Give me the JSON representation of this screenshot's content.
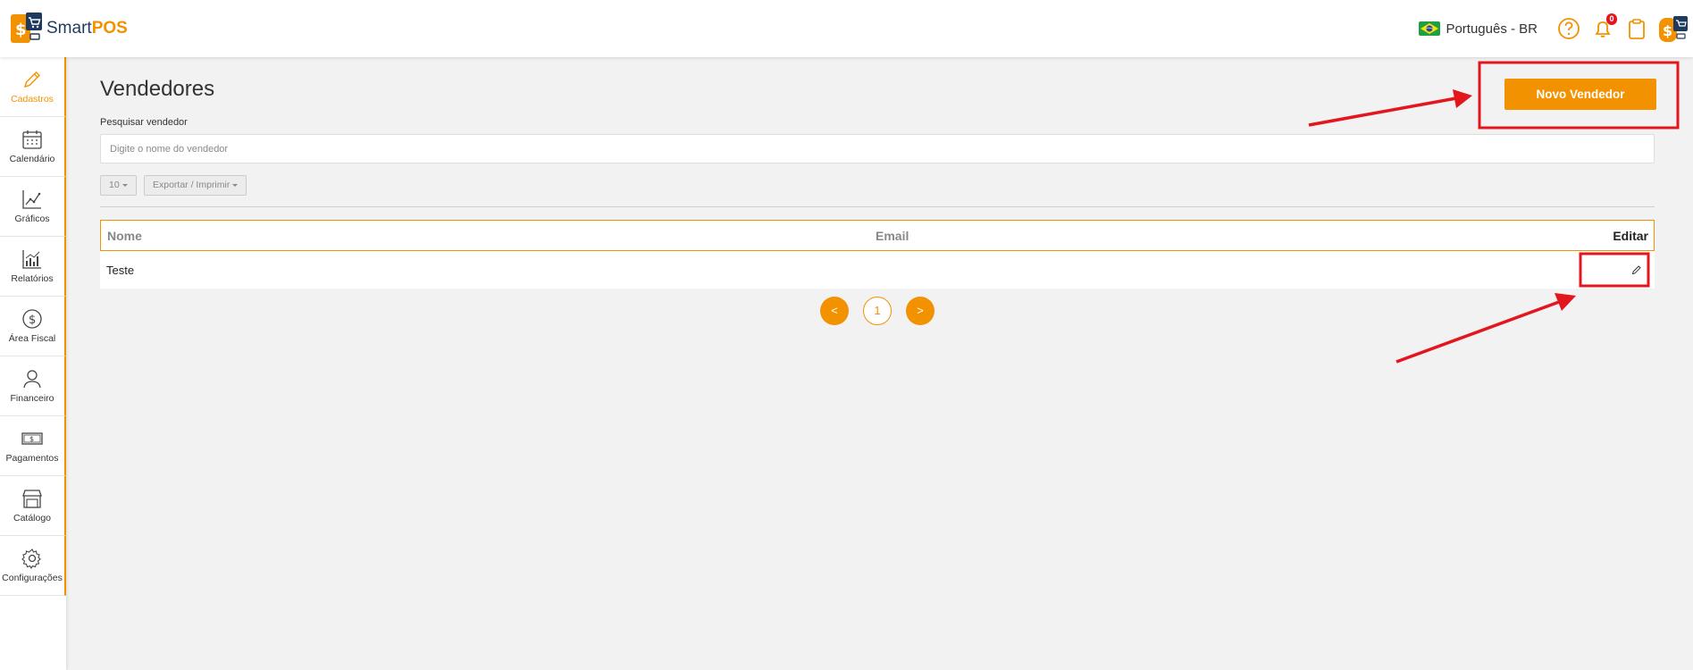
{
  "header": {
    "logo_prefix": "Smart",
    "logo_suffix": "POS",
    "language": "Português - BR",
    "notification_count": "0",
    "icons": [
      "help-icon",
      "bell-icon",
      "clipboard-icon"
    ]
  },
  "sidebar": {
    "items": [
      {
        "label": "Cadastros",
        "icon": "pencil-icon",
        "active": true
      },
      {
        "label": "Calendário",
        "icon": "calendar-icon"
      },
      {
        "label": "Gráficos",
        "icon": "line-chart-icon"
      },
      {
        "label": "Relatórios",
        "icon": "bar-chart-icon"
      },
      {
        "label": "Área Fiscal",
        "icon": "dollar-circle-icon"
      },
      {
        "label": "Financeiro",
        "icon": "user-icon"
      },
      {
        "label": "Pagamentos",
        "icon": "banknote-icon"
      },
      {
        "label": "Catálogo",
        "icon": "store-icon"
      },
      {
        "label": "Configurações",
        "icon": "gear-icon"
      }
    ]
  },
  "main": {
    "title": "Vendedores",
    "new_button_label": "Novo Vendedor",
    "search": {
      "label": "Pesquisar vendedor",
      "placeholder": "Digite o nome do vendedor",
      "value": ""
    },
    "page_size": "10",
    "export_label": "Exportar / Imprimir",
    "table": {
      "columns": [
        "Nome",
        "Email",
        "Editar"
      ],
      "rows": [
        {
          "nome": "Teste",
          "email": ""
        }
      ]
    },
    "pagination": {
      "prev": "<",
      "current": "1",
      "next": ">"
    }
  },
  "colors": {
    "accent": "#f39200",
    "annotation": "#e3161e",
    "navy": "#1e3a5f"
  }
}
